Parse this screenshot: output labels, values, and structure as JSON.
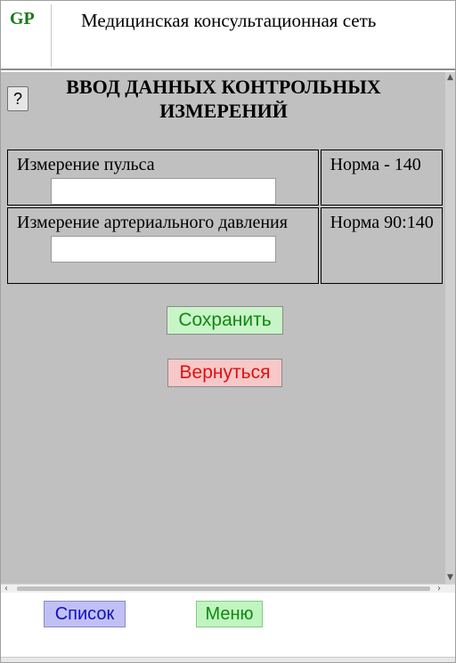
{
  "header": {
    "logo": "GP",
    "title": "Медицинская консультационная сеть"
  },
  "form": {
    "help_label": "?",
    "title": "ВВОД ДАННЫХ КОНТРОЛЬНЫХ ИЗМЕРЕНИЙ",
    "rows": [
      {
        "label": "Измерение пульса",
        "value": "",
        "norm": "Норма - 140"
      },
      {
        "label": "Измерение артериального давления",
        "value": "",
        "norm": "Норма 90:140"
      }
    ],
    "save_label": "Сохранить",
    "back_label": "Вернуться"
  },
  "footer": {
    "list_label": "Список",
    "menu_label": "Меню"
  },
  "colors": {
    "content_bg": "#c0c0c0",
    "logo": "#1a7a1a",
    "save_bg": "#c8f5c8",
    "save_text": "#118811",
    "back_bg": "#f7c8c8",
    "back_text": "#e01010",
    "list_bg": "#c0c0f5",
    "list_text": "#1010c0",
    "menu_bg": "#c0f5c0",
    "menu_text": "#118811"
  },
  "icons": {
    "help": "question-mark",
    "scroll_up": "triangle-up",
    "scroll_down": "triangle-down",
    "scroll_left": "chevron-left",
    "scroll_right": "chevron-right"
  }
}
